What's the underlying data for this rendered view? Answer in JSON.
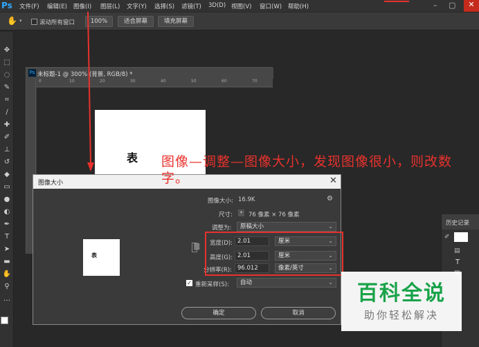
{
  "app": {
    "logo": "Ps"
  },
  "menu": [
    "文件(F)",
    "编辑(E)",
    "图像(I)",
    "图层(L)",
    "文字(Y)",
    "选择(S)",
    "滤镜(T)",
    "3D(D)",
    "视图(V)",
    "窗口(W)",
    "帮助(H)"
  ],
  "options_bar": {
    "scroll_all_label": "滚动所有窗口",
    "zoom_value": "100%",
    "fit_screen": "适合屏幕",
    "fill_screen": "填充屏幕"
  },
  "document": {
    "title": "未标题-1 @ 300% (背景, RGB/8) *",
    "ruler_marks": [
      "0",
      "10",
      "20",
      "30",
      "40",
      "50",
      "60",
      "70"
    ],
    "canvas_text": "表"
  },
  "annotation": {
    "text": "图像—调整—图像大小，发现图像很小，则改数字。"
  },
  "dialog": {
    "title": "图像大小",
    "image_size_label": "图像大小:",
    "image_size_value": "16.9K",
    "dimensions_label": "尺寸:",
    "dimensions_value": "76 像素 × 76 像素",
    "fit_to_label": "调整为:",
    "fit_to_value": "原稿大小",
    "width_label": "宽度(D):",
    "width_value": "2.01",
    "width_unit": "厘米",
    "height_label": "高度(G):",
    "height_value": "2.01",
    "height_unit": "厘米",
    "resolution_label": "分辨率(R):",
    "resolution_value": "96.012",
    "resolution_unit": "像素/英寸",
    "resample_label": "重新采样(S):",
    "resample_value": "自动",
    "ok_button": "确定",
    "cancel_button": "取消",
    "preview_text": "表"
  },
  "history_panel": {
    "tab_label": "历史记录"
  },
  "watermark": {
    "title": "百科全说",
    "subtitle": "助你轻松解决"
  },
  "colors": {
    "accent_red": "#e8322d",
    "ps_blue": "#31a8ff",
    "watermark_green": "#1aa34a"
  }
}
